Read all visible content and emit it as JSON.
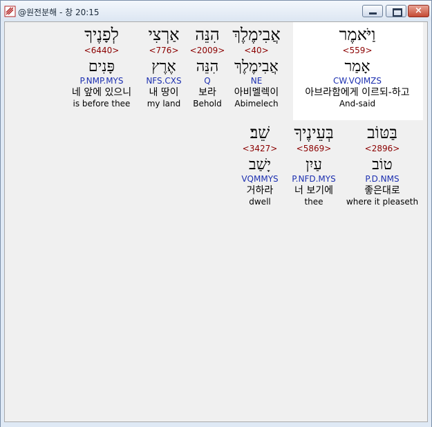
{
  "window": {
    "title": "@원전분해 - 창 20:15",
    "buttons": {
      "minimize": "minimize",
      "maximize": "maximize",
      "close": "×"
    }
  },
  "rows": [
    {
      "words": [
        {
          "hebrew": "וַיֹּאמֶר",
          "strong": "<559>",
          "lemma": "אָמַר",
          "morph": "CW.VQIMZS",
          "korean": "아브라함에게 이르되-하고",
          "english": "And-said",
          "highlighted": true
        },
        {
          "hebrew": "אֲבִימֶלֶךְ",
          "strong": "<40>",
          "lemma": "אֲבִימֶלֶךְ",
          "morph": "NE",
          "korean": "아비멜렉이",
          "english": "Abimelech"
        },
        {
          "hebrew": "הִנֵּה",
          "strong": "<2009>",
          "lemma": "הִנֵּה",
          "morph": "Q",
          "korean": "보라",
          "english": "Behold"
        },
        {
          "hebrew": "אַרְצִי",
          "strong": "<776>",
          "lemma": "אֶרֶץ",
          "morph": "NFS.CXS",
          "korean": "내 땅이",
          "english": "my land"
        },
        {
          "hebrew": "לְפָנֶיךָ",
          "strong": "<6440>",
          "lemma": "פָּנִים",
          "morph": "P.NMP.MYS",
          "korean": "네 앞에 있으니",
          "english": "is before thee"
        }
      ]
    },
    {
      "words": [
        {
          "hebrew": "בַּטּוֹב",
          "strong": "<2896>",
          "lemma": "טוֹב",
          "morph": "P.D.NMS",
          "korean": "좋은대로",
          "english": "where it pleaseth"
        },
        {
          "hebrew": "בְּעֵינֶיךָ",
          "strong": "<5869>",
          "lemma": "עַיִן",
          "morph": "P.NFD.MYS",
          "korean": "너 보기에",
          "english": "thee"
        },
        {
          "hebrew": "שֵׁב׃",
          "strong": "<3427>",
          "lemma": "יָשַׁב",
          "morph": "VQMMYS",
          "korean": "거하라",
          "english": "dwell"
        }
      ]
    }
  ]
}
